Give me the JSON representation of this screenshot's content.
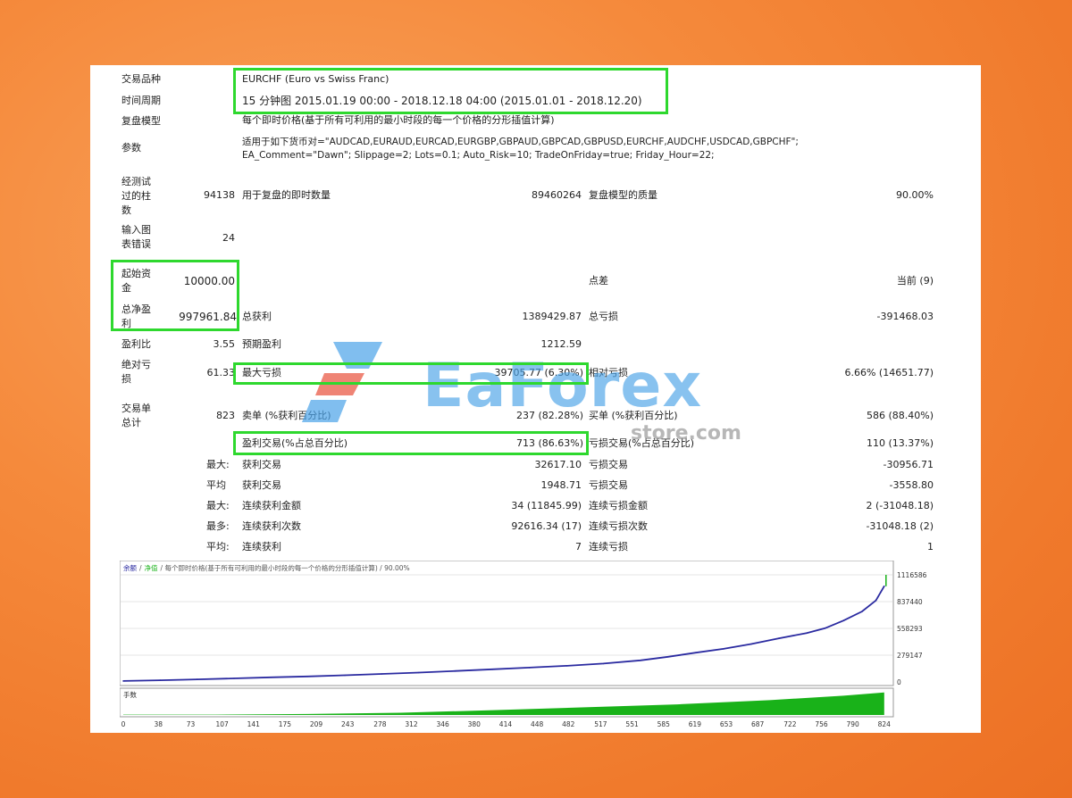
{
  "header": {
    "symbol_label": "交易品种",
    "symbol_value": "EURCHF (Euro vs Swiss Franc)",
    "period_label": "时间周期",
    "period_value": "15 分钟图 2015.01.19 00:00 - 2018.12.18 04:00 (2015.01.01 - 2018.12.20)",
    "model_label": "复盘模型",
    "model_value": "每个即时价格(基于所有可利用的最小时段的每一个价格的分形插值计算)",
    "params_label": "参数",
    "params_line1": "适用于如下货币对=\"AUDCAD,EURAUD,EURCAD,EURGBP,GBPAUD,GBPCAD,GBPUSD,EURCHF,AUDCHF,USDCAD,GBPCHF\";",
    "params_line2": "EA_Comment=\"Dawn\"; Slippage=2; Lots=0.1; Auto_Risk=10; TradeOnFriday=true; Friday_Hour=22;"
  },
  "stats": {
    "bars_label_1": "经测试",
    "bars_label_2": "过的柱",
    "bars_label_3": "数",
    "bars_value": "94138",
    "ticks_label": "用于复盘的即时数量",
    "ticks_value": "89460264",
    "quality_label": "复盘模型的质量",
    "quality_value": "90.00%",
    "errors_label_1": "输入图",
    "errors_label_2": "表错误",
    "errors_value": "24",
    "deposit_label_1": "起始资",
    "deposit_label_2": "金",
    "deposit_value": "10000.00",
    "spread_label": "点差",
    "spread_value": "当前 (9)",
    "netprofit_label_1": "总净盈",
    "netprofit_label_2": "利",
    "netprofit_value": "997961.84",
    "grossprofit_label": "总获利",
    "grossprofit_value": "1389429.87",
    "grossloss_label": "总亏损",
    "grossloss_value": "-391468.03",
    "pf_label": "盈利比",
    "pf_value": "3.55",
    "expected_label": "预期盈利",
    "expected_value": "1212.59",
    "absdd_label_1": "绝对亏",
    "absdd_label_2": "损",
    "absdd_value": "61.33",
    "maxdd_label": "最大亏损",
    "maxdd_value": "39705.77 (6.30%)",
    "reldd_label": "相对亏损",
    "reldd_value": "6.66% (14651.77)",
    "trades_label_1": "交易单",
    "trades_label_2": "总计",
    "trades_value": "823",
    "short_label": "卖单 (%获利百分比)",
    "short_value": "237 (82.28%)",
    "long_label": "买单 (%获利百分比)",
    "long_value": "586 (88.40%)",
    "profit_trades_label": "盈利交易(%占总百分比)",
    "profit_trades_value": "713 (86.63%)",
    "loss_trades_label": "亏损交易(%占总百分比)",
    "loss_trades_value": "110 (13.37%)",
    "max_label": "最大:",
    "largest_profit_label": "获利交易",
    "largest_profit_value": "32617.10",
    "largest_loss_label": "亏损交易",
    "largest_loss_value": "-30956.71",
    "avg_label": "平均",
    "avg_profit_label": "获利交易",
    "avg_profit_value": "1948.71",
    "avg_loss_label": "亏损交易",
    "avg_loss_value": "-3558.80",
    "max2_label": "最大:",
    "consec_wins_money_label": "连续获利金额",
    "consec_wins_money_value": "34 (11845.99)",
    "consec_losses_money_label": "连续亏损金额",
    "consec_losses_money_value": "2 (-31048.18)",
    "most_label": "最多:",
    "consec_wins_count_label": "连续获利次数",
    "consec_wins_count_value": "92616.34 (17)",
    "consec_losses_count_label": "连续亏损次数",
    "consec_losses_count_value": "-31048.18 (2)",
    "avg2_label": "平均:",
    "avg_consec_wins_label": "连续获利",
    "avg_consec_wins_value": "7",
    "avg_consec_losses_label": "连续亏损",
    "avg_consec_losses_value": "1"
  },
  "watermark": {
    "brand": "EaForex",
    "sub": "store.com"
  },
  "colors": {
    "highlight": "#2ed82e",
    "balance_line": "#2a2aa0",
    "volume_fill": "#19b219",
    "watermark_blue": "#4aa3e8",
    "watermark_red": "#e8503a"
  },
  "chart_data": {
    "type": "line",
    "legend_balance": "余额",
    "legend_separator": "/",
    "legend_equity": "净值",
    "legend_description": "/ 每个即时价格(基于所有可利用的最小时段的每一个价格的分形插值计算) / 90.00%",
    "volume_label": "手数",
    "x_ticks": [
      0,
      38,
      73,
      107,
      141,
      175,
      209,
      243,
      278,
      312,
      346,
      380,
      414,
      448,
      482,
      517,
      551,
      585,
      619,
      653,
      687,
      722,
      756,
      790,
      824
    ],
    "y_ticks": [
      0,
      279147,
      558293,
      837440,
      1116586
    ],
    "xlim": [
      0,
      830
    ],
    "ylim": [
      0,
      1116586
    ],
    "series": [
      {
        "values": [
          [
            0,
            10000
          ],
          [
            40,
            18000
          ],
          [
            80,
            27000
          ],
          [
            120,
            37000
          ],
          [
            160,
            48000
          ],
          [
            200,
            58000
          ],
          [
            240,
            70000
          ],
          [
            280,
            84000
          ],
          [
            320,
            98000
          ],
          [
            360,
            114000
          ],
          [
            400,
            132000
          ],
          [
            440,
            150000
          ],
          [
            480,
            168000
          ],
          [
            520,
            192000
          ],
          [
            560,
            225000
          ],
          [
            590,
            262000
          ],
          [
            620,
            305000
          ],
          [
            650,
            345000
          ],
          [
            680,
            395000
          ],
          [
            710,
            455000
          ],
          [
            740,
            510000
          ],
          [
            760,
            560000
          ],
          [
            780,
            640000
          ],
          [
            800,
            735000
          ],
          [
            815,
            850000
          ],
          [
            824,
            997961
          ]
        ]
      }
    ],
    "volume_series": [
      [
        0,
        0.1
      ],
      [
        100,
        0.1
      ],
      [
        200,
        0.3
      ],
      [
        300,
        0.7
      ],
      [
        400,
        1.5
      ],
      [
        500,
        2.4
      ],
      [
        600,
        3.3
      ],
      [
        700,
        4.6
      ],
      [
        780,
        6.0
      ],
      [
        824,
        7.0
      ]
    ],
    "volume_ylim": [
      0,
      7.5
    ]
  }
}
